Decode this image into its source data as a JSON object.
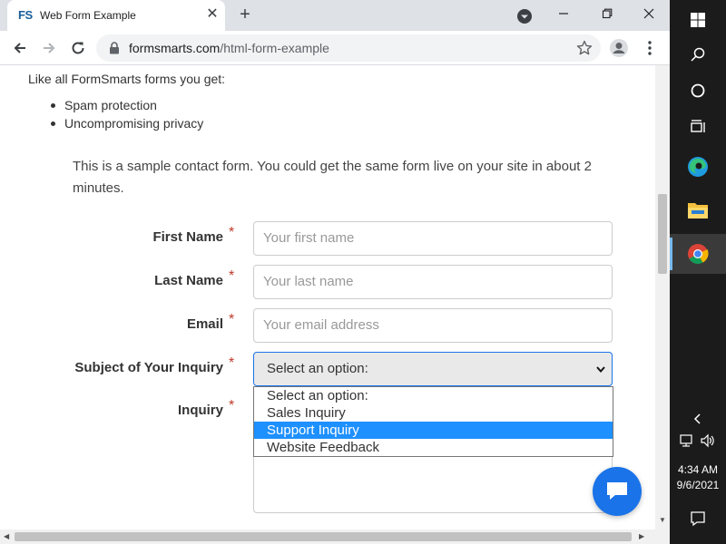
{
  "browser": {
    "tab": {
      "favicon_text": "FS",
      "title": "Web Form Example",
      "close_glyph": "✕"
    },
    "new_tab_glyph": "+",
    "address_bar": {
      "host": "formsmarts.com",
      "path": "/html-form-example"
    }
  },
  "page": {
    "intro": "Like all FormSmarts forms you get:",
    "features": [
      "Spam protection",
      "Uncompromising privacy"
    ],
    "description": "This is a sample contact form. You could get the same form live on your site in about 2 minutes.",
    "form": {
      "required_mark": "*",
      "first_name": {
        "label": "First Name",
        "placeholder": "Your first name"
      },
      "last_name": {
        "label": "Last Name",
        "placeholder": "Your last name"
      },
      "email": {
        "label": "Email",
        "placeholder": "Your email address"
      },
      "subject": {
        "label": "Subject of Your Inquiry",
        "value": "Select an option:",
        "options": [
          "Select an option:",
          "Sales Inquiry",
          "Support Inquiry",
          "Website Feedback"
        ],
        "highlighted": "Support Inquiry"
      },
      "inquiry": {
        "label": "Inquiry"
      }
    }
  },
  "taskbar": {
    "time": "4:34 AM",
    "date": "9/6/2021",
    "accent": "#76b9ed"
  },
  "colors": {
    "link_blue": "#1a73e8",
    "required_red": "#c0392b",
    "selection_blue": "#1e90ff"
  }
}
